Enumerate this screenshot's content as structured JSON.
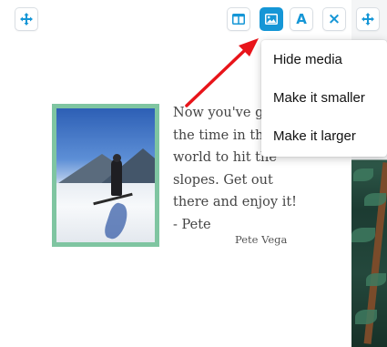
{
  "toolbar": {
    "move_left_icon": "move-arrows-icon",
    "layout_icon": "layout-columns-icon",
    "media_icon": "image-icon",
    "text_label": "A",
    "close_label": "×",
    "move_right_icon": "move-arrows-icon"
  },
  "quote": {
    "text": "Now you've got\nthe time in the\nworld to hit the\nslopes.  Get out\nthere and enjoy it!\n- Pete",
    "author": "Pete Vega"
  },
  "media_menu": {
    "items": [
      {
        "label": "Hide media"
      },
      {
        "label": "Make it smaller"
      },
      {
        "label": "Make it larger"
      }
    ]
  },
  "colors": {
    "accent": "#1596d6",
    "photo_frame": "#7fc5a1",
    "arrow": "#e8141a"
  }
}
